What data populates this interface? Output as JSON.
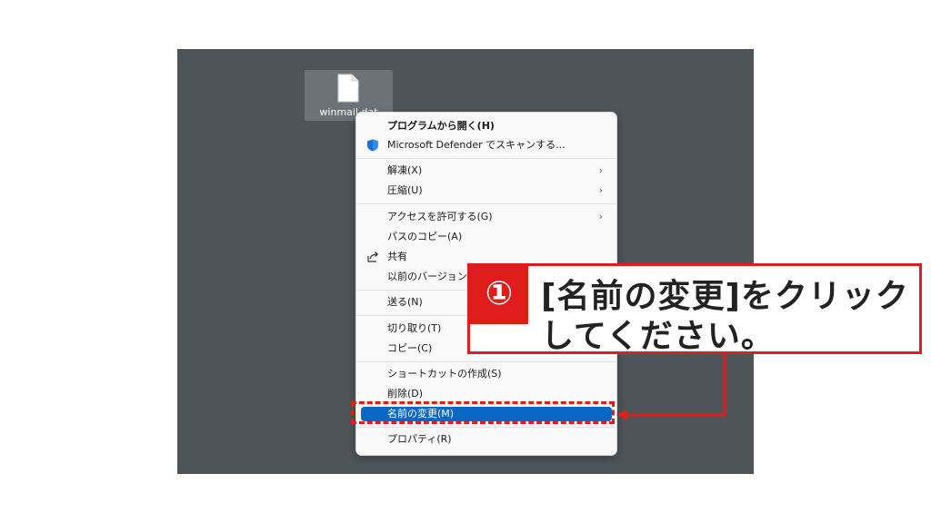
{
  "desktop": {
    "file_name": "winmail.dat"
  },
  "context_menu": {
    "items": [
      {
        "label": "プログラムから開く(H)"
      },
      {
        "label": "Microsoft Defender でスキャンする..."
      },
      {
        "label": "解凍(X)"
      },
      {
        "label": "圧縮(U)"
      },
      {
        "label": "アクセスを許可する(G)"
      },
      {
        "label": "パスのコピー(A)"
      },
      {
        "label": "共有"
      },
      {
        "label": "以前のバージョンの"
      },
      {
        "label": "送る(N)"
      },
      {
        "label": "切り取り(T)"
      },
      {
        "label": "コピー(C)"
      },
      {
        "label": "ショートカットの作成(S)"
      },
      {
        "label": "削除(D)"
      },
      {
        "label": "名前の変更(M)"
      },
      {
        "label": "プロパティ(R)"
      }
    ]
  },
  "callout": {
    "number": "①",
    "line1": "[名前の変更]をクリック",
    "line2": "してください。"
  },
  "colors": {
    "accent_red": "#e01d1d",
    "selection_blue": "#0a67c6",
    "desktop_bg": "#4e5559"
  }
}
